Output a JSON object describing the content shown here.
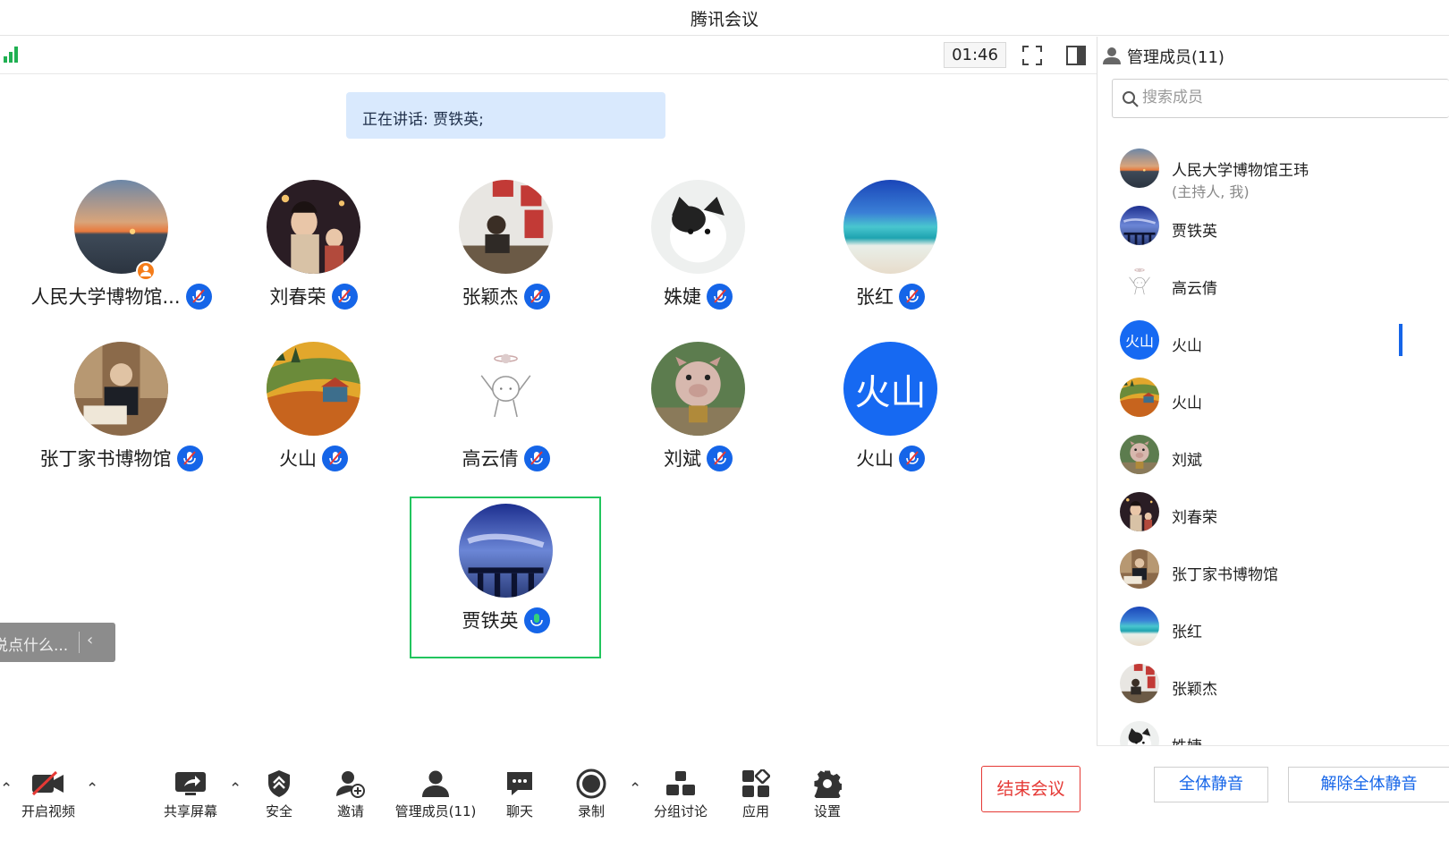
{
  "window": {
    "title": "腾讯会议"
  },
  "topbar": {
    "timer": "01:46"
  },
  "speaking": {
    "label": "正在讲话: 贾铁英;"
  },
  "grid": [
    {
      "name": "人民大学博物馆...",
      "host": true
    },
    {
      "name": "刘春荣"
    },
    {
      "name": "张颖杰"
    },
    {
      "name": "姝婕"
    },
    {
      "name": "张红"
    },
    {
      "name": "张丁家书博物馆"
    },
    {
      "name": "火山"
    },
    {
      "name": "高云倩"
    },
    {
      "name": "刘斌"
    },
    {
      "name": "火山",
      "avatar_text": "火山"
    },
    {
      "name": "贾铁英",
      "speaking": true
    }
  ],
  "chat": {
    "placeholder": "说点什么..."
  },
  "toolbar": {
    "video": "开启视频",
    "share": "共享屏幕",
    "security": "安全",
    "invite": "邀请",
    "members": "管理成员(11)",
    "chat": "聊天",
    "record": "录制",
    "breakout": "分组讨论",
    "apps": "应用",
    "settings": "设置",
    "end": "结束会议"
  },
  "panel": {
    "title": "管理成员(11)",
    "search_placeholder": "搜索成员",
    "members": [
      {
        "name": "人民大学博物馆王玮",
        "sub": "(主持人, 我)"
      },
      {
        "name": "贾铁英"
      },
      {
        "name": "高云倩"
      },
      {
        "name": "火山",
        "avatar_text": "火山"
      },
      {
        "name": "火山"
      },
      {
        "name": "刘斌"
      },
      {
        "name": "刘春荣"
      },
      {
        "name": "张丁家书博物馆"
      },
      {
        "name": "张红"
      },
      {
        "name": "张颖杰"
      },
      {
        "name": "姝婕"
      }
    ],
    "mute_all": "全体静音",
    "unmute_all": "解除全体静音"
  },
  "colors": {
    "accent": "#1565e8",
    "end": "#e53935",
    "focus": "#22c55e"
  }
}
